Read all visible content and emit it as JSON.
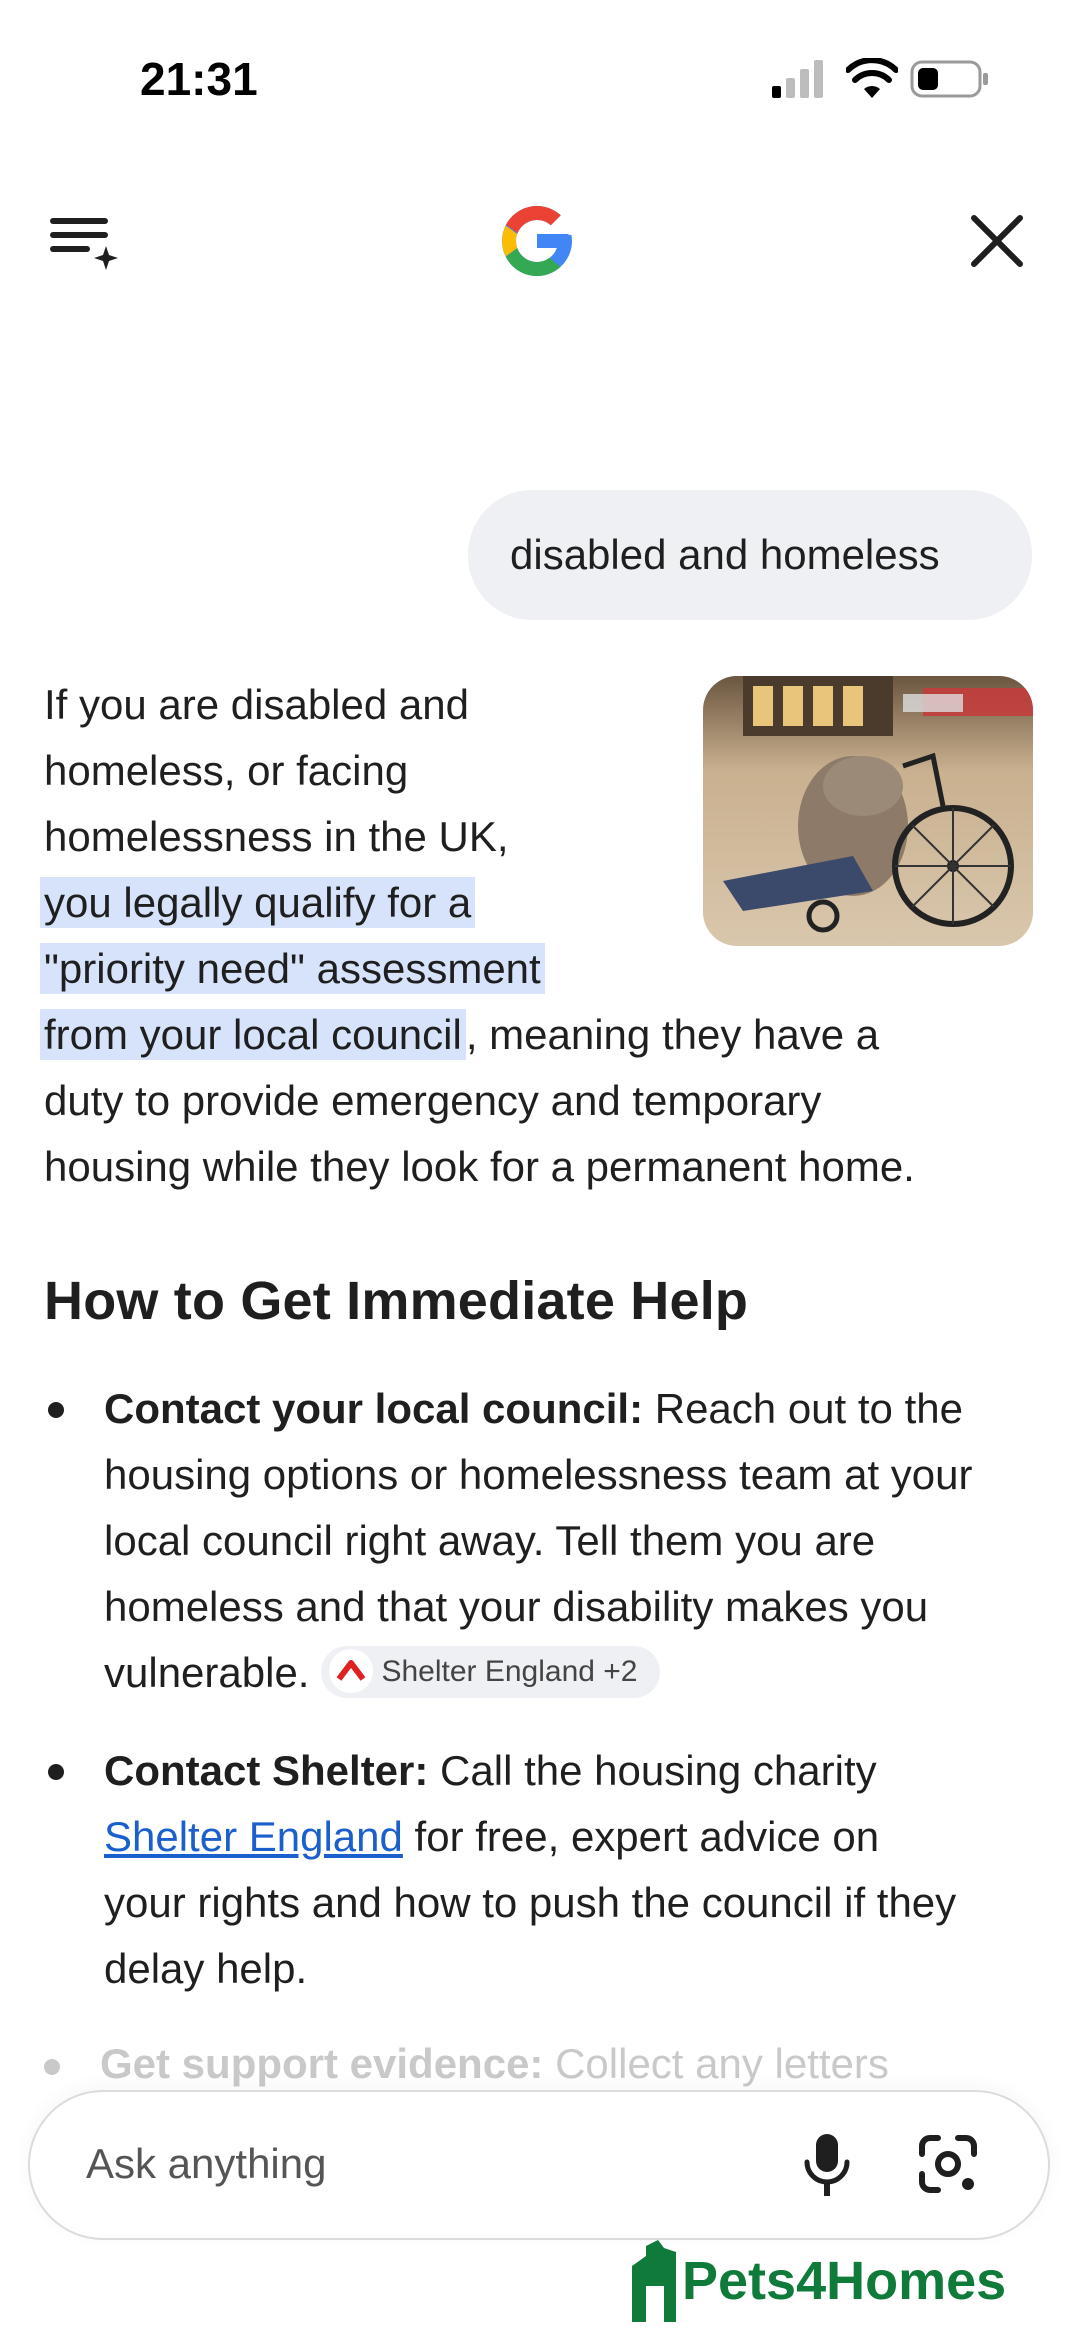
{
  "status_bar": {
    "time": "21:31"
  },
  "topbar": {
    "menu_icon": "ai-menu-icon",
    "logo": "google-logo",
    "close_icon": "close-icon"
  },
  "query": "disabled and homeless",
  "answer": {
    "intro_lines": [
      "If you are disabled and",
      "homeless, or facing",
      "homelessness in the UK,"
    ],
    "highlight_lines": [
      "you legally qualify for a",
      "\"priority need\" assessment",
      "from your local council"
    ],
    "after_highlight": ", meaning they have a",
    "tail_lines": [
      "duty to provide emergency and temporary",
      "housing while they look for a permanent home."
    ],
    "image_alt_icon": "wheelchair-photo"
  },
  "section": {
    "heading": "How to Get Immediate Help",
    "bullets": [
      {
        "bold": "Contact your local council:",
        "lines": [
          " Reach out to the",
          "housing options or homelessness team at your",
          "local council right away. Tell them you are",
          "homeless and that your disability makes you",
          "vulnerable."
        ],
        "chip": "Shelter England +2"
      },
      {
        "bold": "Contact Shelter:",
        "lines": [
          " Call the housing charity",
          " for free, expert advice on",
          "your rights and how to push the council if they",
          "delay help."
        ],
        "link": "Shelter England"
      }
    ],
    "faded_bold": "Get support evidence:",
    "faded_text": " Collect any letters"
  },
  "input": {
    "placeholder": "Ask anything",
    "mic_icon": "mic-icon",
    "lens_icon": "lens-icon"
  },
  "watermark": "Pets4Homes",
  "colors": {
    "highlight": "#d6e3fb",
    "link": "#1a5fcc",
    "bubble": "#eef0f4",
    "watermark": "#0f7a3a"
  }
}
